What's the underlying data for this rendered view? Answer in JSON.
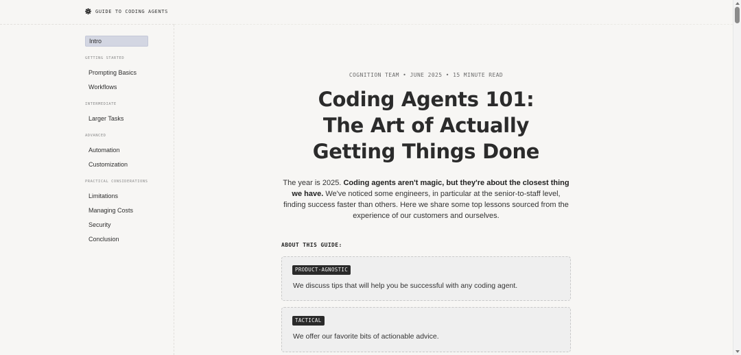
{
  "header": {
    "logo_icon": "snowflake-gear-icon",
    "logo_text": "GUIDE TO CODING AGENTS"
  },
  "sidebar": {
    "intro": "Intro",
    "sections": [
      {
        "heading": "GETTING STARTED",
        "items": [
          "Prompting Basics",
          "Workflows"
        ]
      },
      {
        "heading": "INTERMEDIATE",
        "items": [
          "Larger Tasks"
        ]
      },
      {
        "heading": "ADVANCED",
        "items": [
          "Automation",
          "Customization"
        ]
      },
      {
        "heading": "PRACTICAL CONSIDERATIONS",
        "items": [
          "Limitations",
          "Managing Costs",
          "Security",
          "Conclusion"
        ]
      }
    ]
  },
  "article": {
    "meta": "COGNITION TEAM • JUNE 2025 • 15 MINUTE READ",
    "title_lines": [
      "Coding Agents 101:",
      "The Art of Actually",
      "Getting Things Done"
    ],
    "lede_start": "The year is 2025. ",
    "lede_bold": "Coding agents aren't magic, but they're about the closest thing we have.",
    "lede_end": " We've noticed some engineers, in particular at the senior-to-staff level, finding success faster than others. Here we share some top lessons sourced from the experience of our customers and ourselves.",
    "guide_label": "ABOUT THIS GUIDE:",
    "cards": [
      {
        "tag": "PRODUCT-AGNOSTIC",
        "text": "We discuss tips that will help you be successful with any coding agent."
      },
      {
        "tag": "TACTICAL",
        "text": "We offer our favorite bits of actionable advice."
      }
    ]
  },
  "colors": {
    "background": "#f7f6f4",
    "active_nav": "#d3d6e2",
    "tag_bg": "#2a2a2a",
    "card_bg": "#efefef"
  }
}
